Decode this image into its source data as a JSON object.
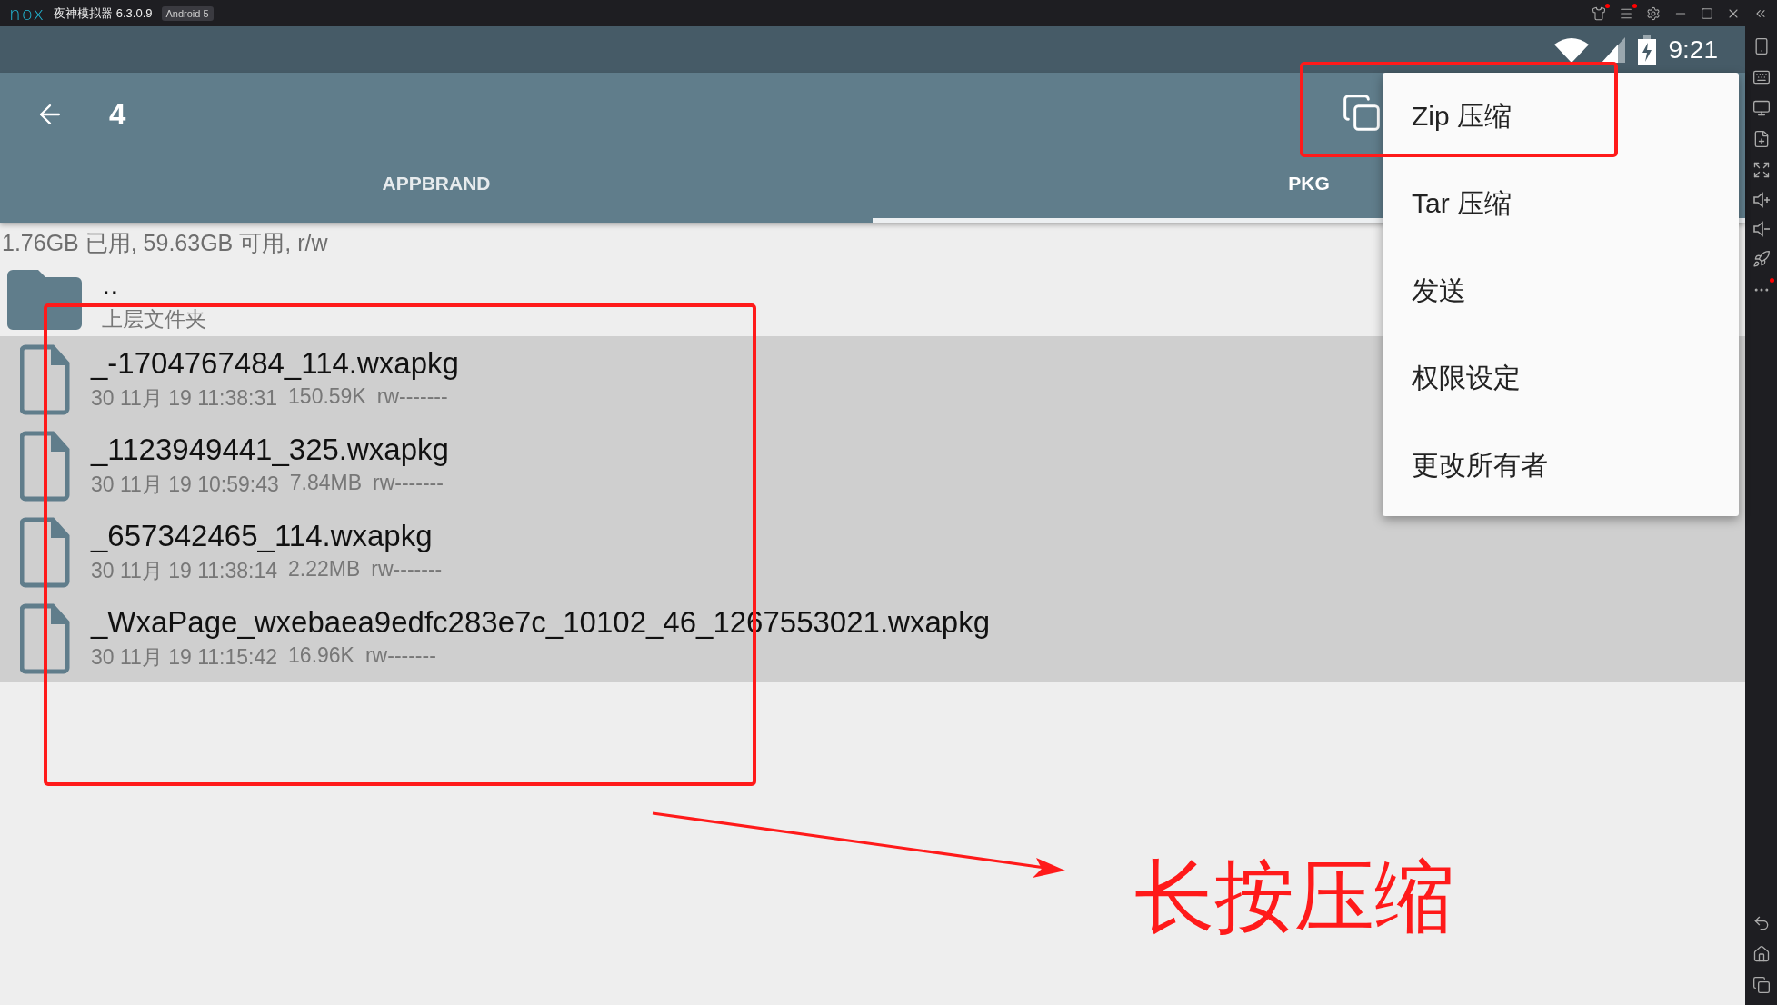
{
  "emulator": {
    "logo": "nox",
    "title": "夜神模拟器 6.3.0.9",
    "badge": "Android 5"
  },
  "status_bar": {
    "time": "9:21"
  },
  "toolbar": {
    "count": "4"
  },
  "tabs": [
    {
      "label": "APPBRAND",
      "selected": false
    },
    {
      "label": "PKG",
      "selected": true
    }
  ],
  "storage_info": "1.76GB 已用, 59.63GB 可用, r/w",
  "files": [
    {
      "kind": "folder",
      "name": "..",
      "details": [
        "上层文件夹"
      ],
      "selected": false
    },
    {
      "kind": "file",
      "name": "_-1704767484_114.wxapkg",
      "details": [
        "30 11月 19 11:38:31",
        "150.59K",
        "rw-------"
      ],
      "selected": true
    },
    {
      "kind": "file",
      "name": "_1123949441_325.wxapkg",
      "details": [
        "30 11月 19 10:59:43",
        "7.84MB",
        "rw-------"
      ],
      "selected": true
    },
    {
      "kind": "file",
      "name": "_657342465_114.wxapkg",
      "details": [
        "30 11月 19 11:38:14",
        "2.22MB",
        "rw-------"
      ],
      "selected": true
    },
    {
      "kind": "file",
      "name": "_WxaPage_wxebaea9edfc283e7c_10102_46_1267553021.wxapkg",
      "details": [
        "30 11月 19 11:15:42",
        "16.96K",
        "rw-------"
      ],
      "selected": true
    }
  ],
  "menu": {
    "items": [
      "Zip 压缩",
      "Tar 压缩",
      "发送",
      "权限设定",
      "更改所有者"
    ]
  },
  "annotation": {
    "note": "长按压缩"
  }
}
